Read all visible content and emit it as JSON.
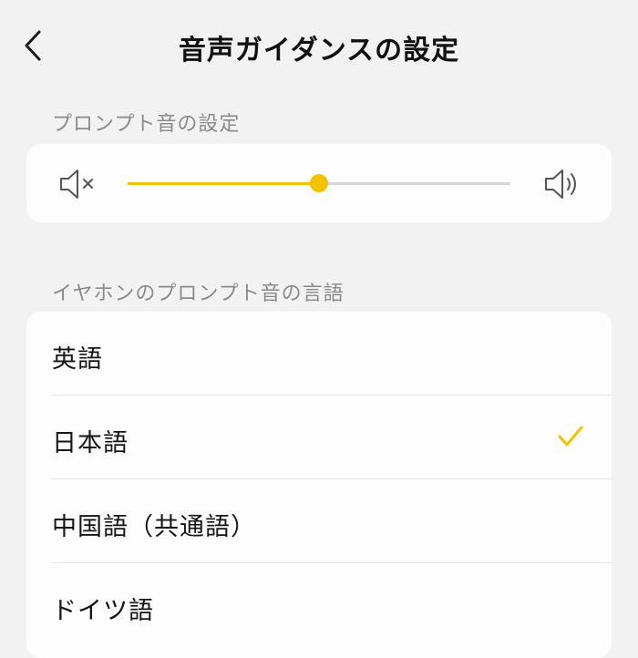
{
  "header": {
    "title": "音声ガイダンスの設定",
    "back_icon": "chevron-left-icon"
  },
  "prompt_sound": {
    "section_label": "プロンプト音の設定",
    "volume_level": 0.5,
    "mute_icon": "speaker-mute-icon",
    "loud_icon": "speaker-loud-icon",
    "accent_color": "#f2c200"
  },
  "language": {
    "section_label": "イヤホンのプロンプト音の言語",
    "items": [
      {
        "label": "英語",
        "selected": false
      },
      {
        "label": "日本語",
        "selected": true
      },
      {
        "label": "中国語（共通語）",
        "selected": false
      },
      {
        "label": "ドイツ語",
        "selected": false
      }
    ],
    "check_icon": "checkmark-icon"
  }
}
